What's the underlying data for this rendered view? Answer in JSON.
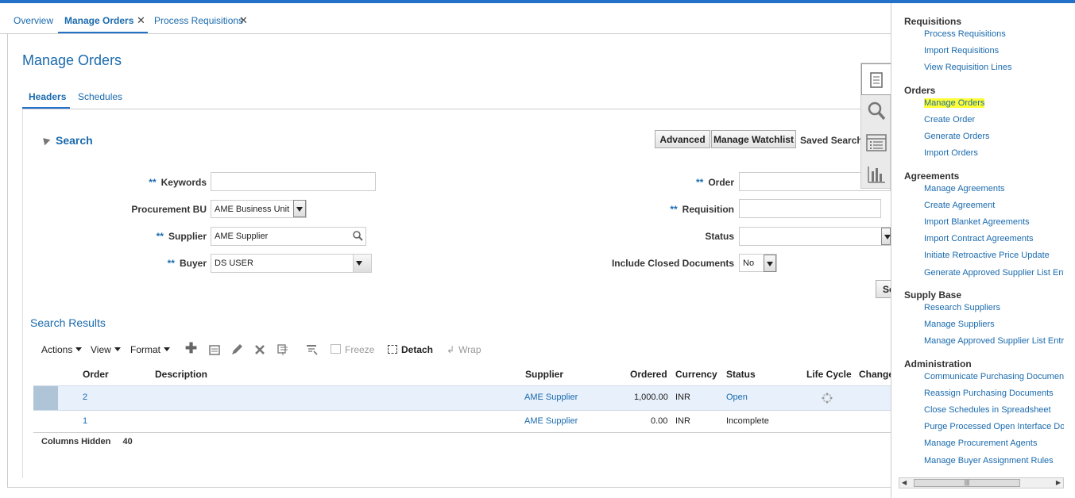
{
  "tabs": [
    {
      "label": "Overview"
    },
    {
      "label": "Manage Orders",
      "close": "✕"
    },
    {
      "label": "Process Requisitions",
      "close": "✕"
    }
  ],
  "page": {
    "title": "Manage Orders"
  },
  "subtabs": [
    {
      "label": "Headers"
    },
    {
      "label": "Schedules"
    }
  ],
  "search": {
    "header": "Search",
    "advanced_label": "Advanced",
    "watchlist_label": "Manage Watchlist",
    "saved_search_label": "Saved Search",
    "search_button_partial": "Se",
    "required_marker": "**",
    "fields": {
      "keywords": {
        "label": "Keywords",
        "value": ""
      },
      "procurement_bu": {
        "label": "Procurement BU",
        "value": "AME Business Unit"
      },
      "supplier": {
        "label": "Supplier",
        "value": "AME Supplier"
      },
      "buyer": {
        "label": "Buyer",
        "value": "DS USER"
      },
      "order": {
        "label": "Order",
        "value": ""
      },
      "requisition": {
        "label": "Requisition",
        "value": ""
      },
      "status": {
        "label": "Status",
        "value": ""
      },
      "include_closed": {
        "label": "Include Closed Documents",
        "value": "No"
      }
    }
  },
  "results": {
    "title": "Search Results",
    "toolbar": {
      "actions": "Actions",
      "view": "View",
      "format": "Format",
      "freeze": "Freeze",
      "detach": "Detach",
      "wrap": "Wrap"
    },
    "columns": [
      "Order",
      "Description",
      "Supplier",
      "Ordered",
      "Currency",
      "Status",
      "Life Cycle",
      "Change"
    ],
    "rows": [
      {
        "order": "2",
        "description": "",
        "supplier": "AME Supplier",
        "ordered": "1,000.00",
        "currency": "INR",
        "status": "Open",
        "status_link": true
      },
      {
        "order": "1",
        "description": "",
        "supplier": "AME Supplier",
        "ordered": "0.00",
        "currency": "INR",
        "status": "Incomplete",
        "status_link": false
      }
    ],
    "columns_hidden_label": "Columns Hidden",
    "columns_hidden_count": "40"
  },
  "tasks_panel": {
    "sections": [
      {
        "title": "Requisitions",
        "items": [
          "Process Requisitions",
          "Import Requisitions",
          "View Requisition Lines"
        ]
      },
      {
        "title": "Orders",
        "items": [
          "Manage Orders",
          "Create Order",
          "Generate Orders",
          "Import Orders"
        ],
        "highlighted": "Manage Orders"
      },
      {
        "title": "Agreements",
        "items": [
          "Manage Agreements",
          "Create Agreement",
          "Import Blanket Agreements",
          "Import Contract Agreements",
          "Initiate Retroactive Price Update",
          "Generate Approved Supplier List Ent"
        ]
      },
      {
        "title": "Supply Base",
        "items": [
          "Research Suppliers",
          "Manage Suppliers",
          "Manage Approved Supplier List Entri"
        ]
      },
      {
        "title": "Administration",
        "items": [
          "Communicate Purchasing Documents",
          "Reassign Purchasing Documents",
          "Close Schedules in Spreadsheet",
          "Purge Processed Open Interface Doc",
          "Manage Procurement Agents",
          "Manage Buyer Assignment Rules"
        ]
      }
    ]
  },
  "colors": {
    "accent": "#2472c8",
    "link": "#1a6aad",
    "highlight": "#ffff33",
    "selected_row": "#e8f0fb"
  },
  "icons": [
    "tasks-icon",
    "search-icon",
    "list-icon",
    "chart-icon",
    "add-icon",
    "duplicate-icon",
    "edit-icon",
    "delete-icon",
    "export-icon",
    "query-icon",
    "lifecycle-icon"
  ]
}
